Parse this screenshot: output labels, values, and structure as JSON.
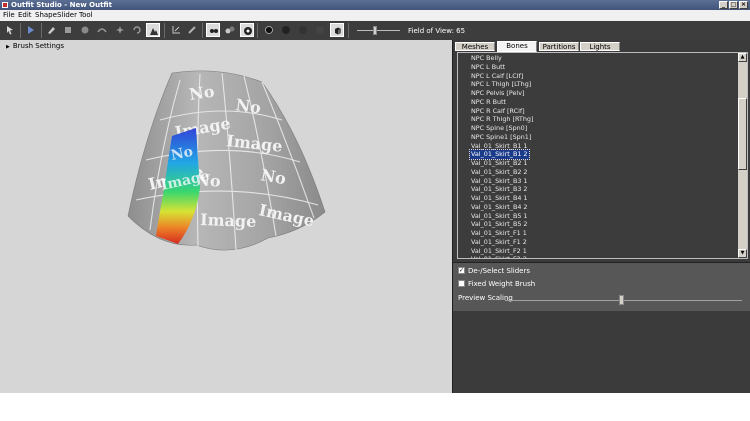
{
  "window": {
    "title": "Outfit Studio - New Outfit"
  },
  "titlebar_buttons": {
    "minimize": "_",
    "maximize": "□",
    "close": "×"
  },
  "menu": [
    "File",
    "Edit",
    "Shape",
    "Slider",
    "Tool"
  ],
  "toolbar": {
    "field_of_view_label": "Field of View: 65",
    "icons": [
      "select-icon",
      "transform-icon",
      "brush-icon",
      "inflate-brush-icon",
      "deflate-brush-icon",
      "move-brush-icon",
      "smooth-brush-icon",
      "undo-icon",
      "redo-icon",
      "mask-brush-icon",
      "weight-paint-icon",
      "edit-vertex-icon",
      "segment-icon",
      "vertex-color-icon",
      "wireframe-icon",
      "lighting-icon",
      "texture-icon"
    ]
  },
  "viewport": {
    "brush_settings_label": "Brush Settings",
    "texture_text": [
      "No",
      "Image"
    ]
  },
  "tabs": [
    "Meshes",
    "Bones",
    "Partitions",
    "Lights"
  ],
  "active_tab": "Bones",
  "bones": [
    "NPC Belly",
    "NPC L Butt",
    "NPC L Calf [LClf]",
    "NPC L Thigh [LThg]",
    "NPC Pelvis [Pelv]",
    "NPC R Butt",
    "NPC R Calf [RClf]",
    "NPC R Thigh [RThg]",
    "NPC Spine [Spn0]",
    "NPC Spine1 [Spn1]",
    "Val_01_Skirt_B1 1",
    "Val_01_Skirt_B1 2",
    "Val_01_Skirt_B2 1",
    "Val_01_Skirt_B2 2",
    "Val_01_Skirt_B3 1",
    "Val_01_Skirt_B3 2",
    "Val_01_Skirt_B4 1",
    "Val_01_Skirt_B4 2",
    "Val_01_Skirt_B5 1",
    "Val_01_Skirt_B5 2",
    "Val_01_Skirt_F1 1",
    "Val_01_Skirt_F1 2",
    "Val_01_Skirt_F2 1",
    "Val_01_Skirt_F2 2"
  ],
  "selected_bone": "Val_01_Skirt_B1 2",
  "options": {
    "deselect_sliders_label": "De-/Select Sliders",
    "deselect_sliders_checked": true,
    "fixed_weight_brush_label": "Fixed Weight Brush",
    "fixed_weight_brush_checked": false,
    "preview_scaling_label": "Preview Scaling",
    "preview_scaling_fraction": 0.49
  },
  "colors": {
    "titlebar": "#4a5d85",
    "toolbar": "#3d3d3d",
    "panel": "#3b3b3b",
    "viewport": "#d6d6d6",
    "selection": "#1a3a8a"
  }
}
